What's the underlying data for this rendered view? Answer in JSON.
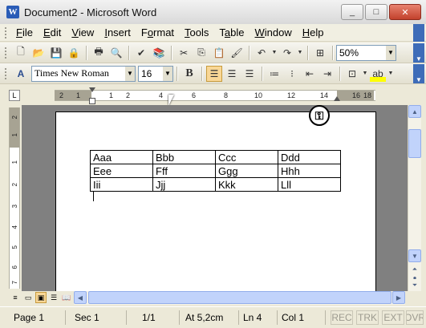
{
  "window": {
    "title": "Document2 - Microsoft Word",
    "app_icon": "W",
    "minimize_glyph": "_",
    "maximize_glyph": "□",
    "close_glyph": "✕"
  },
  "menu": {
    "items": [
      {
        "underline": "F",
        "rest": "ile"
      },
      {
        "underline": "E",
        "rest": "dit"
      },
      {
        "underline": "V",
        "rest": "iew"
      },
      {
        "underline": "I",
        "rest": "nsert"
      },
      {
        "underline": "F",
        "rest": "ormat",
        "prefix": ""
      },
      {
        "underline": "T",
        "rest": "ools"
      },
      {
        "underline": "T",
        "rest": "able",
        "prefix": ""
      },
      {
        "underline": "W",
        "rest": "indow"
      },
      {
        "underline": "H",
        "rest": "elp"
      }
    ]
  },
  "standard_toolbar": {
    "zoom": "50%"
  },
  "format_toolbar": {
    "font": "Times New Roman",
    "size": "16",
    "bold": "B"
  },
  "ruler": {
    "h_numbers": [
      "2",
      "1",
      "1",
      "2",
      "4",
      "6",
      "8",
      "10",
      "12",
      "14",
      "16",
      "18"
    ],
    "v_numbers": [
      "2",
      "1",
      "1",
      "2",
      "3",
      "4",
      "5",
      "6",
      "7"
    ],
    "corner": "L"
  },
  "table": [
    [
      "Aaa",
      "Bbb",
      "Ccc",
      "Ddd"
    ],
    [
      "Eee",
      "Fff",
      "Ggg",
      "Hhh"
    ],
    [
      "Iii",
      "Jjj",
      "Kkk",
      "Lll"
    ]
  ],
  "status": {
    "page": "Page 1",
    "sec": "Sec 1",
    "pages": "1/1",
    "at": "At 5,2cm",
    "ln": "Ln 4",
    "col": "Col 1",
    "rec": "REC",
    "trk": "TRK",
    "ext": "EXT",
    "ovr": "OVR"
  },
  "colors": {
    "accent": "#3E6CB8",
    "active_button": "#F9D796"
  }
}
